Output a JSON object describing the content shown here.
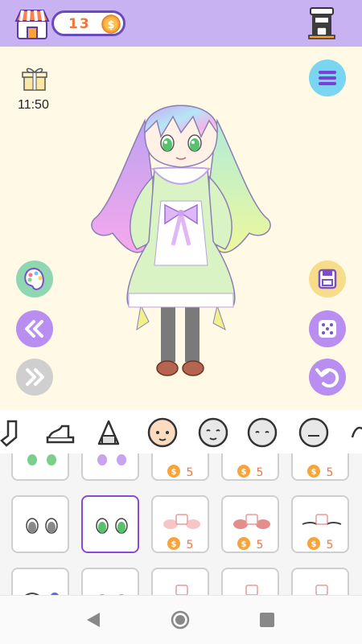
{
  "header": {
    "coins": "13",
    "coin_symbol": "$"
  },
  "stage": {
    "timer": "11:50"
  },
  "icons": {
    "shop": "shop-icon",
    "coin": "coin-icon",
    "coffee": "coffee-machine-icon",
    "gift": "gift-icon",
    "menu": "menu-icon",
    "palette": "palette-icon",
    "back": "double-left-icon",
    "forward": "double-right-icon",
    "save": "save-icon",
    "dice": "dice-icon",
    "undo": "undo-icon"
  },
  "categories": [
    "sock",
    "shoe",
    "bag",
    "face-skin",
    "face-1",
    "face-2",
    "face-3",
    "more"
  ],
  "item_price": "5",
  "colors": {
    "topbar": "#c9b2f1",
    "stage_bg": "#fff9e5",
    "accent_purple": "#8c49d6",
    "coin_orange": "#f0763a"
  }
}
